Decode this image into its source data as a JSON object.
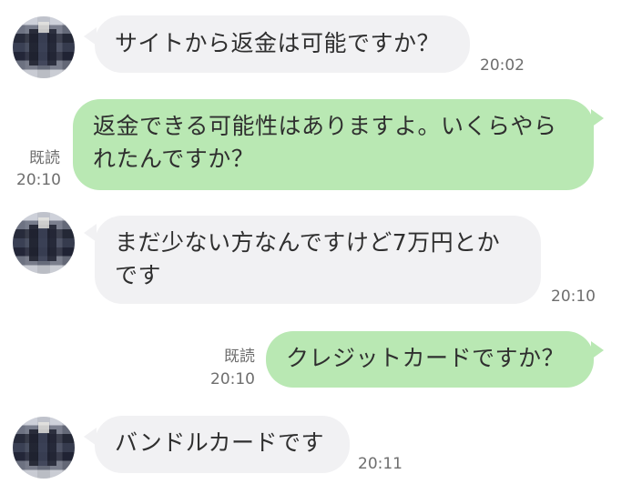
{
  "messages": [
    {
      "from": "other",
      "text": "サイトから返金は可能ですか？",
      "time": "20:02"
    },
    {
      "from": "me",
      "line1": "返金できる可能性はありますよ。いくらやら",
      "line2": "れたんですか？",
      "read": "既読",
      "time": "20:10"
    },
    {
      "from": "other",
      "line1": "まだ少ない方なんですけど7万円とか",
      "line2": "です",
      "time": "20:10"
    },
    {
      "from": "me",
      "text": "クレジットカードですか？",
      "read": "既読",
      "time": "20:10"
    },
    {
      "from": "other",
      "text": "バンドルカードです",
      "time": "20:11"
    }
  ],
  "colors": {
    "received_bubble": "#f1f1f3",
    "sent_bubble": "#b9e8b3",
    "text": "#2f2f2f",
    "meta": "#6e6e6e"
  }
}
